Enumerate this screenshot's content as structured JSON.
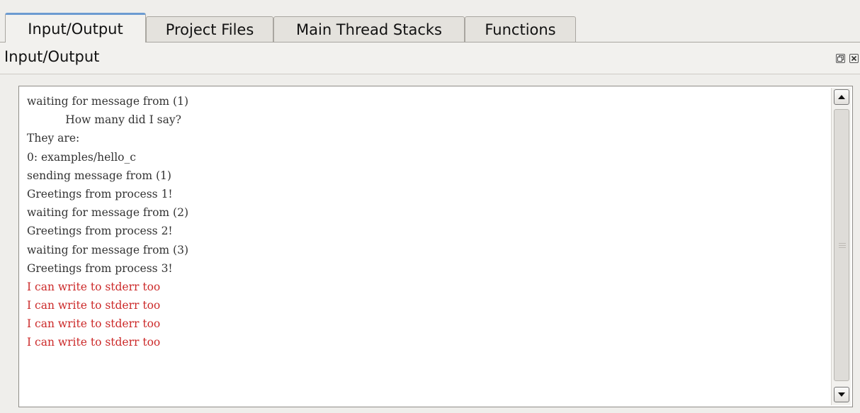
{
  "tabs": [
    {
      "label": "Input/Output",
      "active": true
    },
    {
      "label": "Project Files",
      "active": false
    },
    {
      "label": "Main Thread Stacks",
      "active": false
    },
    {
      "label": "Functions",
      "active": false
    }
  ],
  "panel": {
    "title": "Input/Output",
    "float_icon": "float-window-icon",
    "close_icon": "close-icon"
  },
  "colors": {
    "stdout": "#333333",
    "stderr": "#cc2a2a",
    "active_tab_accent": "#6c9bd1"
  },
  "output": {
    "lines": [
      {
        "text": "waiting for message from (1)",
        "stream": "stdout"
      },
      {
        "text": "           How many did I say?",
        "stream": "stdout"
      },
      {
        "text": "They are:",
        "stream": "stdout"
      },
      {
        "text": "0: examples/hello_c",
        "stream": "stdout"
      },
      {
        "text": "sending message from (1)",
        "stream": "stdout"
      },
      {
        "text": "Greetings from process 1!",
        "stream": "stdout"
      },
      {
        "text": "waiting for message from (2)",
        "stream": "stdout"
      },
      {
        "text": "Greetings from process 2!",
        "stream": "stdout"
      },
      {
        "text": "waiting for message from (3)",
        "stream": "stdout"
      },
      {
        "text": "Greetings from process 3!",
        "stream": "stdout"
      },
      {
        "text": "I can write to stderr too",
        "stream": "stderr"
      },
      {
        "text": "I can write to stderr too",
        "stream": "stderr"
      },
      {
        "text": "I can write to stderr too",
        "stream": "stderr"
      },
      {
        "text": "I can write to stderr too",
        "stream": "stderr"
      }
    ]
  },
  "scrollbar": {
    "up_icon": "arrow-up-icon",
    "down_icon": "arrow-down-icon"
  }
}
